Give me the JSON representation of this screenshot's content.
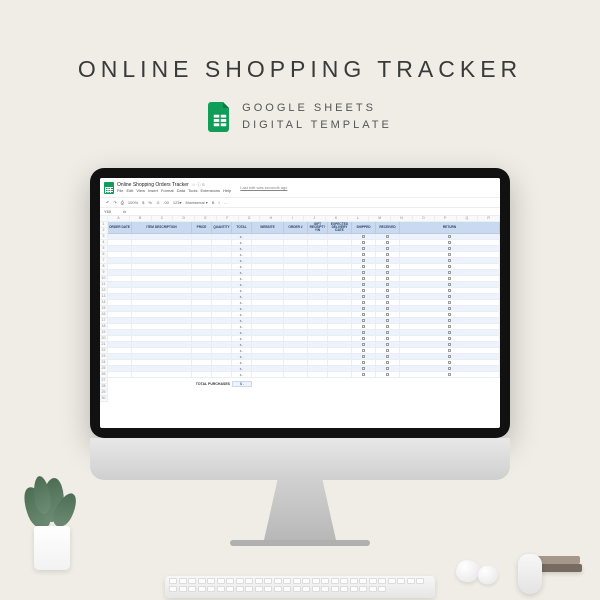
{
  "hero": {
    "title": "ONLINE SHOPPING TRACKER",
    "subtitle_line1": "GOOGLE SHEETS",
    "subtitle_line2": "DIGITAL TEMPLATE"
  },
  "sheets_app": {
    "doc_title": "Online Shopping Orders Tracker",
    "doc_icons": "☆ ⓘ ⊙",
    "menu": [
      "File",
      "Edit",
      "View",
      "Insert",
      "Format",
      "Data",
      "Tools",
      "Extensions",
      "Help"
    ],
    "status": "Last edit was seconds ago",
    "toolbar": {
      "undo": "↶",
      "redo": "↷",
      "print": "⎙",
      "zoom": "100%",
      "currency": "$",
      "percent": "%",
      "decimal": ".0",
      "decDec": ".00",
      "moreFmt": "123▾",
      "font": "Montserrat ▾",
      "bold": "B",
      "italic": "I",
      "more": "…"
    },
    "cell_ref": "Y60",
    "fx_label": "fx",
    "col_letters": [
      "A",
      "B",
      "C",
      "D",
      "E",
      "F",
      "G",
      "H",
      "I",
      "J",
      "K",
      "L",
      "M",
      "N",
      "O",
      "P",
      "Q",
      "R"
    ],
    "row_numbers_visible": 30,
    "table": {
      "columns": [
        "ORDER DATE",
        "ITEM DESCRIPTION",
        "PRICE",
        "QUANTITY",
        "TOTAL",
        "WEBSITE",
        "ORDER #",
        "GIFT RECEIPT? Y/N",
        "EXPECTED DELIVERY DATE",
        "SHIPPED",
        "RECEIVED",
        "RETURN"
      ],
      "currency_placeholder": "$  -",
      "num_rows": 24,
      "total_label": "TOTAL PURCHASES",
      "total_value": "$  -"
    }
  }
}
